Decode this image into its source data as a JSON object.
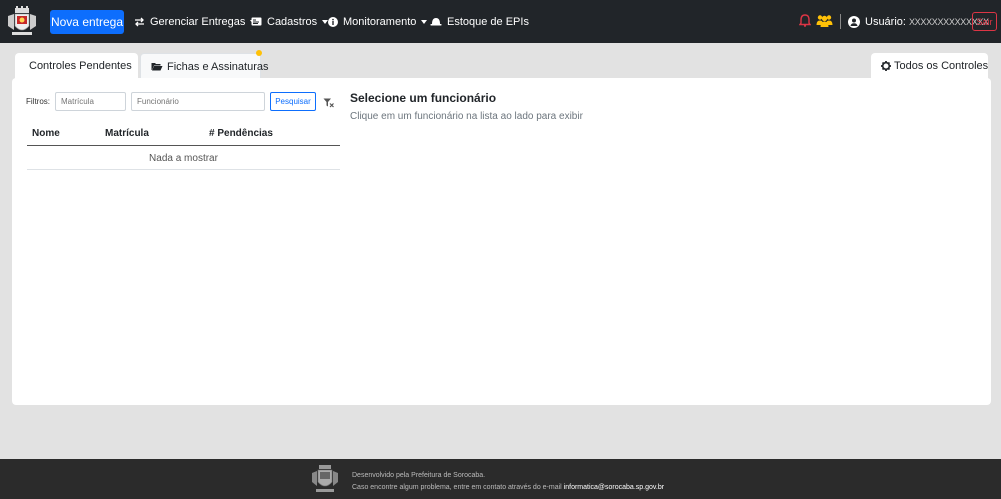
{
  "navbar": {
    "logo_icon": "sorocaba-coat-of-arms-icon",
    "new_button": "Nova entrega",
    "menu": [
      {
        "label": "Gerenciar Entregas",
        "icon": "exchange-arrows-icon",
        "dropdown": true
      },
      {
        "label": "Cadastros",
        "icon": "id-card-icon",
        "dropdown": true
      },
      {
        "label": "Monitoramento",
        "icon": "info-circle-icon",
        "dropdown": true
      },
      {
        "label": "Estoque de EPIs",
        "icon": "hard-hat-icon",
        "dropdown": false
      }
    ],
    "user_label": "Usuário:",
    "user_name": "XXXXXXXXXXXXXX",
    "logout": "Sair",
    "colors": {
      "bg": "#212529",
      "primary": "#0d6efd",
      "danger": "#dc3545",
      "warning": "#ffc107"
    }
  },
  "tabs": {
    "pending": "Controles Pendentes",
    "sheets": "Fichas e Assinaturas",
    "all": "Todos os Controles"
  },
  "filters": {
    "label": "Filtros:",
    "matricula_placeholder": "Matrícula",
    "funcionario_placeholder": "Funcionário",
    "search_button": "Pesquisar"
  },
  "table": {
    "columns": [
      "Nome",
      "Matrícula",
      "# Pendências"
    ],
    "empty_text": "Nada a mostrar"
  },
  "detail": {
    "title": "Selecione um funcionário",
    "subtitle": "Clique em um funcionário na lista ao lado para exibir"
  },
  "footer": {
    "line1": "Desenvolvido pela Prefeitura de Sorocaba.",
    "line2": "Caso encontre algum problema, entre em contato através do e-mail",
    "email": "informatica@sorocaba.sp.gov.br"
  }
}
